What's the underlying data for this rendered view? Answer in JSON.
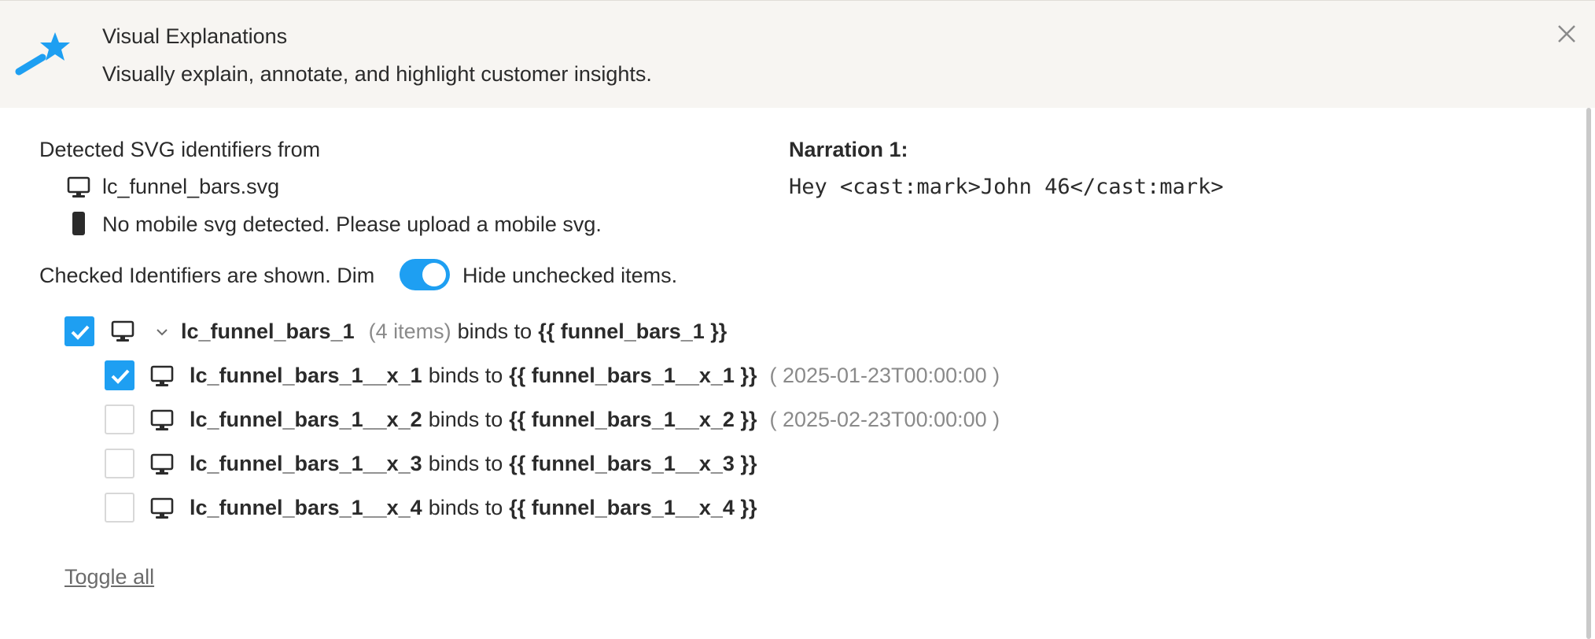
{
  "header": {
    "title": "Visual Explanations",
    "subtitle": "Visually explain, annotate, and highlight customer insights.",
    "accent_color": "#1e9ff2",
    "icon": "magic-wand-icon",
    "close_icon": "close-icon"
  },
  "detected": {
    "label": "Detected SVG identifiers from",
    "desktop_file": "lc_funnel_bars.svg",
    "mobile_message": "No mobile svg detected. Please upload a mobile svg."
  },
  "narration": {
    "label": "Narration 1:",
    "text": "Hey <cast:mark>John 46</cast:mark>"
  },
  "display_options": {
    "prefix": "Checked Identifiers are shown. Dim",
    "suffix": "Hide unchecked items.",
    "hide_unchecked": true
  },
  "tree": {
    "parent": {
      "name": "lc_funnel_bars_1",
      "count": "(4 items)",
      "binds_to": "binds to",
      "binding": "{{ funnel_bars_1 }}",
      "checked": true,
      "expanded": true
    },
    "children": [
      {
        "name": "lc_funnel_bars_1__x_1",
        "binds_to": "binds to",
        "binding": "{{ funnel_bars_1__x_1 }}",
        "value": "( 2025-01-23T00:00:00 )",
        "checked": true
      },
      {
        "name": "lc_funnel_bars_1__x_2",
        "binds_to": "binds to",
        "binding": "{{ funnel_bars_1__x_2 }}",
        "value": "( 2025-02-23T00:00:00 )",
        "checked": false
      },
      {
        "name": "lc_funnel_bars_1__x_3",
        "binds_to": "binds to",
        "binding": "{{ funnel_bars_1__x_3 }}",
        "value": "",
        "checked": false
      },
      {
        "name": "lc_funnel_bars_1__x_4",
        "binds_to": "binds to",
        "binding": "{{ funnel_bars_1__x_4 }}",
        "value": "",
        "checked": false
      }
    ]
  },
  "toggle_all_label": "Toggle all"
}
